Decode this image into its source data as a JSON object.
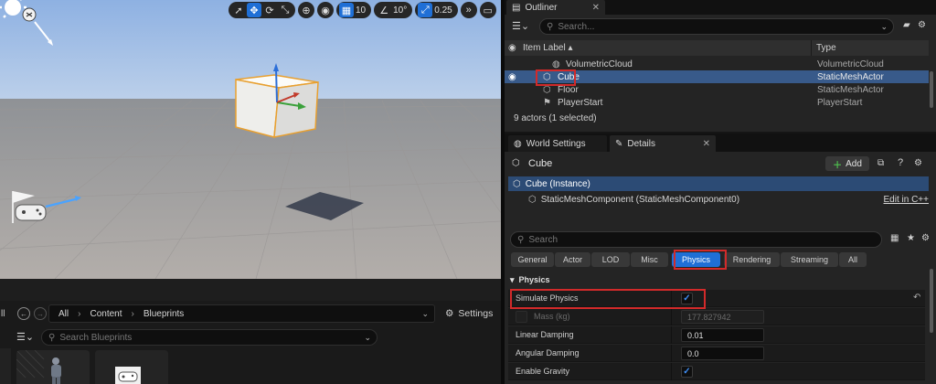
{
  "viewport": {
    "toolbar": {
      "grid_snap_value": "10",
      "rotation_snap_value": "10°",
      "scale_snap_value": "0.25"
    }
  },
  "content_browser": {
    "all_label": "ll",
    "path": [
      "All",
      "Content",
      "Blueprints"
    ],
    "settings_label": "Settings",
    "search_placeholder": "Search Blueprints"
  },
  "outliner": {
    "tab_label": "Outliner",
    "search_placeholder": "Search...",
    "column_label": "Item Label ▴",
    "column_type": "Type",
    "rows": [
      {
        "label": "VolumetricCloud",
        "type": "VolumetricCloud"
      },
      {
        "label": "Cube",
        "type": "StaticMeshActor"
      },
      {
        "label": "Floor",
        "type": "StaticMeshActor"
      },
      {
        "label": "PlayerStart",
        "type": "PlayerStart"
      }
    ],
    "footer": "9 actors (1 selected)"
  },
  "details": {
    "tab_world_settings": "World Settings",
    "tab_details": "Details",
    "actor_name": "Cube",
    "add_label": "Add",
    "instance_label": "Cube (Instance)",
    "component_label": "StaticMeshComponent (StaticMeshComponent0)",
    "edit_link": "Edit in C++",
    "search_placeholder": "Search",
    "categories": [
      "General",
      "Actor",
      "LOD",
      "Misc",
      "Physics",
      "Rendering",
      "Streaming",
      "All"
    ],
    "active_category": "Physics",
    "section_title": "Physics",
    "properties": {
      "simulate_physics": {
        "label": "Simulate Physics",
        "checked": true
      },
      "mass": {
        "label": "Mass (kg)",
        "value": "177.827942"
      },
      "linear_damping": {
        "label": "Linear Damping",
        "value": "0.01"
      },
      "angular_damping": {
        "label": "Angular Damping",
        "value": "0.0"
      },
      "enable_gravity": {
        "label": "Enable Gravity",
        "checked": true
      }
    }
  },
  "colors": {
    "accent": "#1f6fd6",
    "selection": "#385a8a",
    "highlight": "#d22a2a"
  }
}
